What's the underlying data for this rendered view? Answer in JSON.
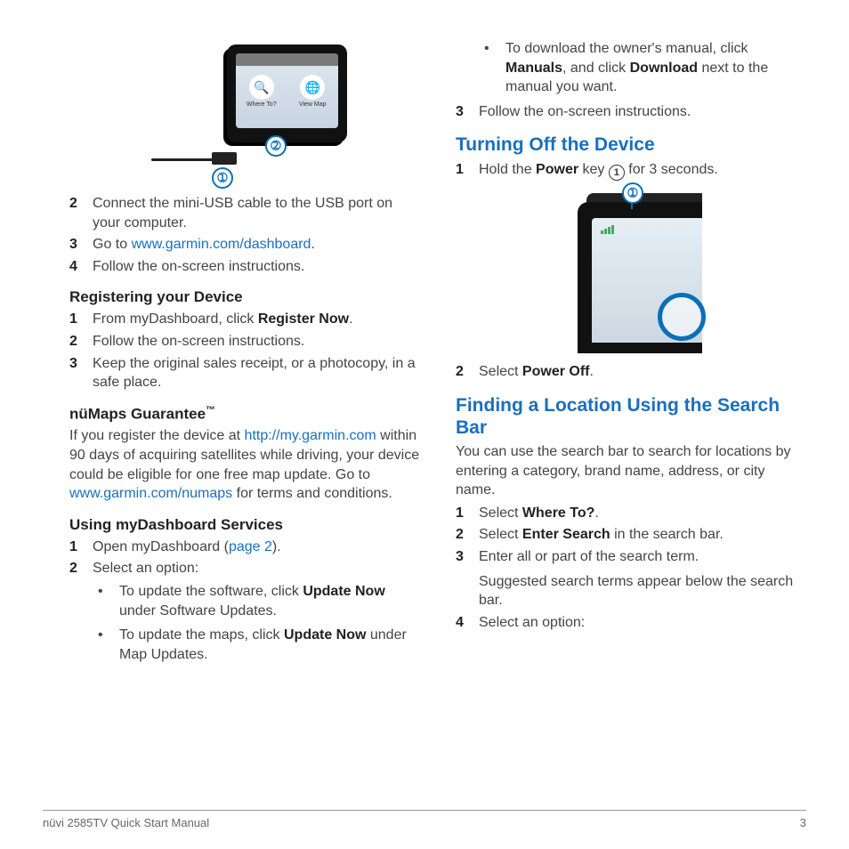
{
  "left": {
    "step2": "Connect the mini-USB cable to the USB port on your computer.",
    "step3_pre": "Go to ",
    "step3_link": "www.garmin.com/dashboard",
    "step3_post": ".",
    "step4": "Follow the on-screen instructions.",
    "reg_heading": "Registering your Device",
    "reg1_pre": "From myDashboard, click ",
    "reg1_b": "Register Now",
    "reg1_post": ".",
    "reg2": "Follow the on-screen instructions.",
    "reg3": "Keep the original sales receipt, or a photocopy, in a safe place.",
    "numaps_heading": "nüMaps Guarantee",
    "numaps_tm": "™",
    "numaps_p1": "If you register the device at ",
    "numaps_link1": "http://my.garmin.com",
    "numaps_p2": " within 90 days of acquiring satellites while driving, your device could be eligible for one free map update. Go to ",
    "numaps_link2": "www.garmin.com/numaps",
    "numaps_p3": " for terms and conditions.",
    "using_heading": "Using myDashboard Services",
    "use1_pre": "Open myDashboard (",
    "use1_link": "page 2",
    "use1_post": ").",
    "use2": "Select an option:",
    "use2a_pre": "To update the software, click ",
    "use2a_b": "Update Now",
    "use2a_post": " under Software Updates.",
    "use2b_pre": "To update the maps, click ",
    "use2b_b": "Update Now",
    "use2b_post": " under Map Updates.",
    "dev_icon1": "Where To?",
    "dev_icon2": "View Map"
  },
  "right": {
    "dl_pre": "To download the owner's manual, click ",
    "dl_b1": "Manuals",
    "dl_mid": ", and click ",
    "dl_b2": "Download",
    "dl_post": " next to the manual you want.",
    "step3": "Follow the on-screen instructions.",
    "turnoff_heading": "Turning Off the Device",
    "turn1_pre": "Hold the ",
    "turn1_b": "Power",
    "turn1_mid": " key ",
    "turn1_post": " for 3 seconds.",
    "turn2_pre": "Select ",
    "turn2_b": "Power Off",
    "turn2_post": ".",
    "find_heading": "Finding a Location Using the Search Bar",
    "find_para": "You can use the search bar to search for locations by entering a category, brand name, address, or city name.",
    "find1_pre": "Select ",
    "find1_b": "Where To?",
    "find1_post": ".",
    "find2_pre": "Select ",
    "find2_b": "Enter Search",
    "find2_post": " in the search bar.",
    "find3": "Enter all or part of the search term.",
    "find3_sub": "Suggested search terms appear below the search bar.",
    "find4": "Select an option:"
  },
  "nums": {
    "n1": "1",
    "n2": "2",
    "n3": "3",
    "n4": "4",
    "bullet": "•",
    "c1": "➀",
    "c2": "➁"
  },
  "footer": {
    "left": "nüvi 2585TV Quick Start Manual",
    "right": "3"
  }
}
